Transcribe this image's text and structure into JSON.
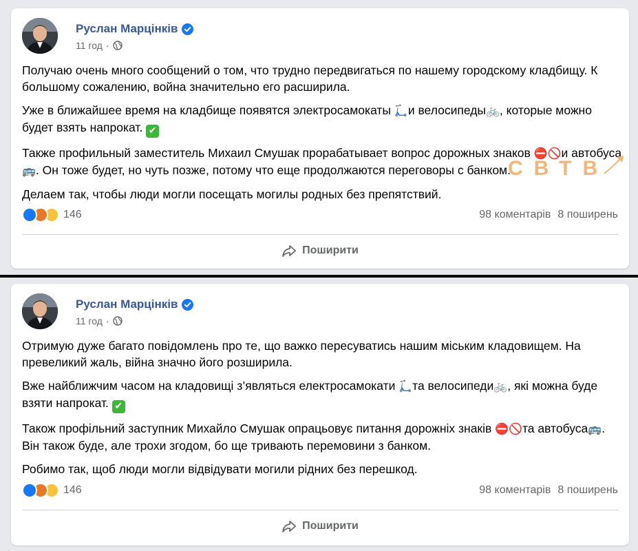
{
  "posts": [
    {
      "author": "Руслан Марцінків",
      "time": "11 год",
      "paragraphs": {
        "p1": "Получаю очень много сообщений о том, что трудно передвигаться по нашему городскому кладбищу. К большому сожалению, война значительно его расширила.",
        "p2a": "Уже в ближайшее время на кладбище появятся электросамокаты ",
        "p2b": "и велосипеды",
        "p2c": ", которые можно будет взять напрокат. ",
        "p3a": "Также профильный заместитель Михаил Смушак прорабатывает вопрос дорожных знаков ",
        "p3b": "и автобуса",
        "p3c": ". Он тоже будет, но чуть позже, потому что еще продолжаются переговоры с банком.",
        "p4": "Делаем так, чтобы люди могли посещать могилы родных без препятствий."
      },
      "reaction_count": "146",
      "comments": "98 коментарів",
      "shares": "8 поширень",
      "share_label": "Поширити"
    },
    {
      "author": "Руслан Марцінків",
      "time": "11 год",
      "paragraphs": {
        "p1": "Отримую дуже багато повідомлень про те, що важко пересуватись нашим міським кладовищем. На превеликий жаль, війна значно його розширила.",
        "p2a": "Вже найближчим часом на кладовищі з’являться електросамокати ",
        "p2b": "та велосипеди",
        "p2c": ", які можна буде взяти напрокат. ",
        "p3a": "Також профільний заступник Михайло Смушак опрацьовує питання дорожніх знаків ",
        "p3b": "та автобуса",
        "p3c": ". Він також буде, але трохи згодом, бо ще тривають перемовини з банком.",
        "p4": "Робимо так, щоб люди могли відвідувати могили рідних без перешкод."
      },
      "reaction_count": "146",
      "comments": "98 коментарів",
      "shares": "8 поширень",
      "share_label": "Поширити"
    }
  ],
  "watermark": "СВТВ",
  "icons": {
    "scooter": "🛴",
    "bicycle": "🚲",
    "no_entry": "⛔🚫",
    "bus": "🚌",
    "check": "✔"
  },
  "colors": {
    "author": "#385898",
    "meta": "#65676b",
    "like": "#1877f2",
    "angry": "#e8772a",
    "haha": "#f7c33d",
    "check": "#3eb53b",
    "watermark": "#f2b57a"
  }
}
